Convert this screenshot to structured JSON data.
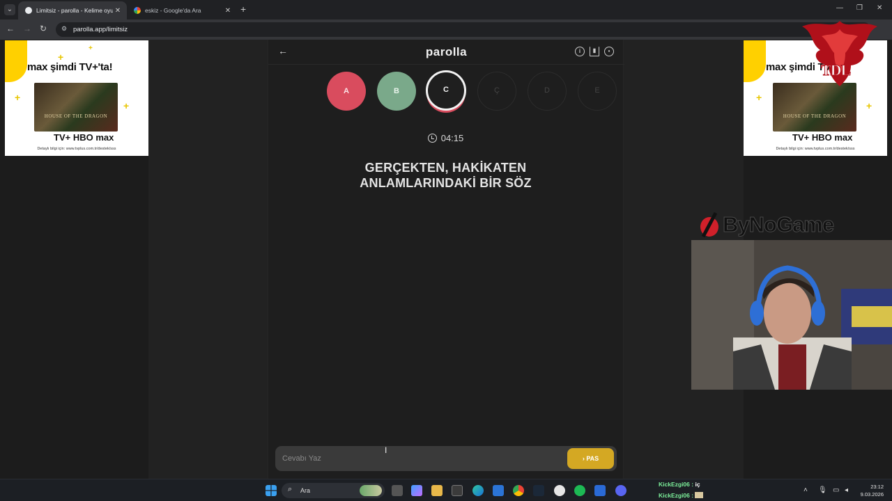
{
  "browser": {
    "tabs": [
      {
        "title": "Limitsiz - parolla - Kelime oyun",
        "active": true
      },
      {
        "title": "eskiz - Google'da Ara",
        "active": false
      }
    ],
    "url": "parolla.app/limitsiz"
  },
  "ads": {
    "left": {
      "title": "max şimdi TV+'ta!",
      "poster_text": "HOUSE OF THE DRAGON",
      "brand": "TV+ HBO max",
      "footer": "Detaylı bilgi için: www.tvplus.com.tr/destek/sss"
    },
    "right": {
      "title": "max şimdi TV+'ta!",
      "poster_text": "HOUSE OF THE DRAGON",
      "brand": "TV+ HBO max",
      "footer": "Detaylı bilgi için: www.tvplus.com.tr/destek/sss"
    }
  },
  "game": {
    "logo": "parolla",
    "letters": [
      {
        "label": "A",
        "state": "wrong"
      },
      {
        "label": "B",
        "state": "right"
      },
      {
        "label": "C",
        "state": "current"
      },
      {
        "label": "Ç",
        "state": "pending"
      },
      {
        "label": "D",
        "state": "pending"
      },
      {
        "label": "E",
        "state": "pending"
      }
    ],
    "timer": "04:15",
    "question_line1": "GERÇEKTEN, HAKİKATEN",
    "question_line2": "ANLAMLARINDAKİ BİR SÖZ",
    "answer_placeholder": "Cevabı Yaz",
    "pass_label": "PAS"
  },
  "overlay": {
    "tdl": "TDL",
    "bynogame": "ByNoGame"
  },
  "taskbar": {
    "search": "Ara",
    "chat": [
      {
        "user": "KickEzgi06 :",
        "msg": "iç"
      },
      {
        "user": "KickEzgi06 :",
        "msg": ""
      }
    ],
    "time": "23:12",
    "date": "9.03.2026"
  },
  "colors": {
    "wrong": "#d94c5e",
    "right": "#7aa98a",
    "pass": "#d4a823"
  }
}
